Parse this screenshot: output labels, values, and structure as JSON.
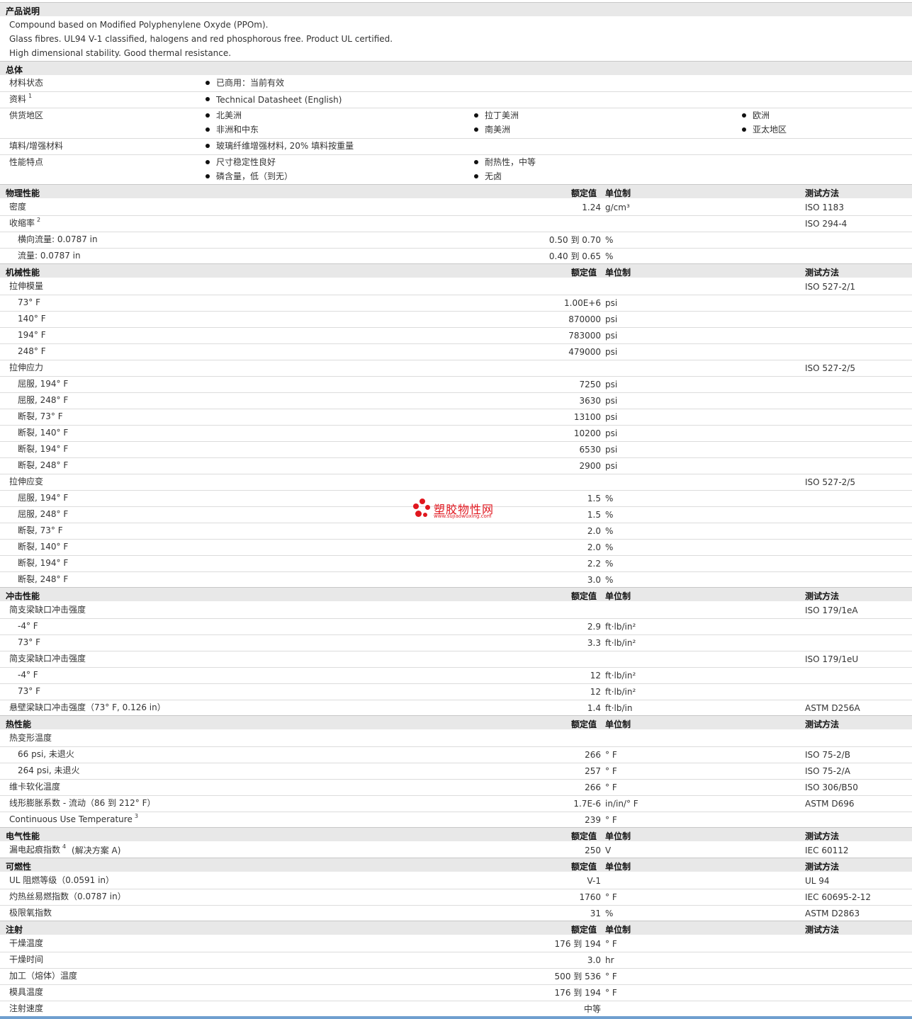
{
  "sections": {
    "description": "产品说明",
    "general": "总体",
    "physical": "物理性能",
    "mechanical": "机械性能",
    "impact": "冲击性能",
    "thermal": "热性能",
    "electrical": "电气性能",
    "flammability": "可燃性",
    "injection": "注射"
  },
  "table_headers": {
    "value": "额定值",
    "unit": "单位制",
    "method": "测试方法"
  },
  "description_lines": [
    "Compound based on Modified Polyphenylene Oxyde (PPOm).",
    "Glass fibres. UL94 V-1 classified, halogens and red phosphorous free. Product UL certified.",
    "High dimensional stability. Good thermal resistance."
  ],
  "general": {
    "status_label": "材料状态",
    "status_value": "已商用：当前有效",
    "docs_label": "资料",
    "docs_sup": "1",
    "docs_link": "Technical Datasheet (English)",
    "regions_label": "供货地区",
    "regions": [
      "北美洲",
      "拉丁美洲",
      "欧洲",
      "非洲和中东",
      "南美洲",
      "亚太地区"
    ],
    "filler_label": "填料/增强材料",
    "filler_value": "玻璃纤维增强材料, 20% 填料按重量",
    "features_label": "性能特点",
    "features": [
      "尺寸稳定性良好",
      "耐热性，中等",
      "磷含量，低（到无）",
      "无卤"
    ]
  },
  "physical_rows": [
    {
      "prop": "密度",
      "value": "1.24",
      "unit": "g/cm³",
      "method": "ISO 1183",
      "sub": false
    },
    {
      "prop": "收缩率",
      "sup": "2",
      "value": "",
      "unit": "",
      "method": "ISO 294-4",
      "sub": false
    },
    {
      "prop": "横向流量: 0.0787 in",
      "value": "0.50 到  0.70",
      "unit": "%",
      "method": "",
      "sub": true
    },
    {
      "prop": "流量: 0.0787 in",
      "value": "0.40 到  0.65",
      "unit": "%",
      "method": "",
      "sub": true
    }
  ],
  "mechanical_rows": [
    {
      "prop": "拉伸模量",
      "value": "",
      "unit": "",
      "method": "ISO 527-2/1",
      "sub": false
    },
    {
      "prop": "73° F",
      "value": "1.00E+6",
      "unit": "psi",
      "method": "",
      "sub": true
    },
    {
      "prop": "140° F",
      "value": "870000",
      "unit": "psi",
      "method": "",
      "sub": true
    },
    {
      "prop": "194° F",
      "value": "783000",
      "unit": "psi",
      "method": "",
      "sub": true
    },
    {
      "prop": "248° F",
      "value": "479000",
      "unit": "psi",
      "method": "",
      "sub": true
    },
    {
      "prop": "拉伸应力",
      "value": "",
      "unit": "",
      "method": "ISO 527-2/5",
      "sub": false
    },
    {
      "prop": "屈服, 194° F",
      "value": "7250",
      "unit": "psi",
      "method": "",
      "sub": true
    },
    {
      "prop": "屈服, 248° F",
      "value": "3630",
      "unit": "psi",
      "method": "",
      "sub": true
    },
    {
      "prop": "断裂, 73° F",
      "value": "13100",
      "unit": "psi",
      "method": "",
      "sub": true
    },
    {
      "prop": "断裂, 140° F",
      "value": "10200",
      "unit": "psi",
      "method": "",
      "sub": true
    },
    {
      "prop": "断裂, 194° F",
      "value": "6530",
      "unit": "psi",
      "method": "",
      "sub": true
    },
    {
      "prop": "断裂, 248° F",
      "value": "2900",
      "unit": "psi",
      "method": "",
      "sub": true
    },
    {
      "prop": "拉伸应变",
      "value": "",
      "unit": "",
      "method": "ISO 527-2/5",
      "sub": false
    },
    {
      "prop": "屈服, 194° F",
      "value": "1.5",
      "unit": "%",
      "method": "",
      "sub": true
    },
    {
      "prop": "屈服, 248° F",
      "value": "1.5",
      "unit": "%",
      "method": "",
      "sub": true
    },
    {
      "prop": "断裂, 73° F",
      "value": "2.0",
      "unit": "%",
      "method": "",
      "sub": true
    },
    {
      "prop": "断裂, 140° F",
      "value": "2.0",
      "unit": "%",
      "method": "",
      "sub": true
    },
    {
      "prop": "断裂, 194° F",
      "value": "2.2",
      "unit": "%",
      "method": "",
      "sub": true
    },
    {
      "prop": "断裂, 248° F",
      "value": "3.0",
      "unit": "%",
      "method": "",
      "sub": true
    }
  ],
  "impact_rows": [
    {
      "prop": "简支梁缺口冲击强度",
      "value": "",
      "unit": "",
      "method": "ISO 179/1eA",
      "sub": false
    },
    {
      "prop": "-4° F",
      "value": "2.9",
      "unit": "ft·lb/in²",
      "method": "",
      "sub": true
    },
    {
      "prop": "73° F",
      "value": "3.3",
      "unit": "ft·lb/in²",
      "method": "",
      "sub": true
    },
    {
      "prop": "简支梁缺口冲击强度",
      "value": "",
      "unit": "",
      "method": "ISO 179/1eU",
      "sub": false
    },
    {
      "prop": "-4° F",
      "value": "12",
      "unit": "ft·lb/in²",
      "method": "",
      "sub": true
    },
    {
      "prop": "73° F",
      "value": "12",
      "unit": "ft·lb/in²",
      "method": "",
      "sub": true
    },
    {
      "prop": "悬壁梁缺口冲击强度（73° F, 0.126 in）",
      "value": "1.4",
      "unit": "ft·lb/in",
      "method": "ASTM D256A",
      "sub": false
    }
  ],
  "thermal_rows": [
    {
      "prop": "热变形温度",
      "value": "",
      "unit": "",
      "method": "",
      "sub": false
    },
    {
      "prop": "66 psi, 未退火",
      "value": "266",
      "unit": "° F",
      "method": "ISO 75-2/B",
      "sub": true
    },
    {
      "prop": "264 psi, 未退火",
      "value": "257",
      "unit": "° F",
      "method": "ISO 75-2/A",
      "sub": true
    },
    {
      "prop": "维卡软化温度",
      "value": "266",
      "unit": "° F",
      "method": "ISO 306/B50",
      "sub": false
    },
    {
      "prop": "线形膨胀系数 - 流动（86 到 212° F）",
      "value": "1.7E-6",
      "unit": "in/in/° F",
      "method": "ASTM D696",
      "sub": false
    },
    {
      "prop": "Continuous Use Temperature",
      "sup": "3",
      "value": "239",
      "unit": "° F",
      "method": "",
      "sub": false
    }
  ],
  "electrical_rows": [
    {
      "prop": "漏电起痕指数",
      "sup": "4",
      "suffix": "(解决方案 A)",
      "value": "250",
      "unit": "V",
      "method": "IEC 60112",
      "sub": false
    }
  ],
  "flammability_rows": [
    {
      "prop": "UL 阻燃等级（0.0591 in）",
      "value": "V-1",
      "unit": "",
      "method": "UL 94",
      "sub": false
    },
    {
      "prop": "灼热丝易燃指数（0.0787 in）",
      "value": "1760",
      "unit": "° F",
      "method": "IEC 60695-2-12",
      "sub": false
    },
    {
      "prop": "极限氧指数",
      "value": "31",
      "unit": "%",
      "method": "ASTM D2863",
      "sub": false
    }
  ],
  "injection_rows": [
    {
      "prop": "干燥温度",
      "value": "176 到  194",
      "unit": "° F",
      "method": "",
      "sub": false
    },
    {
      "prop": "干燥时间",
      "value": "3.0",
      "unit": "hr",
      "method": "",
      "sub": false
    },
    {
      "prop": "加工（熔体）温度",
      "value": "500 到  536",
      "unit": "° F",
      "method": "",
      "sub": false
    },
    {
      "prop": "模具温度",
      "value": "176 到  194",
      "unit": "° F",
      "method": "",
      "sub": false
    },
    {
      "prop": "注射速度",
      "value": "中等",
      "unit": "",
      "method": "",
      "sub": false
    }
  ],
  "watermark": {
    "title": "塑胶物性网",
    "url": "www.sujiaowuxing.com"
  }
}
